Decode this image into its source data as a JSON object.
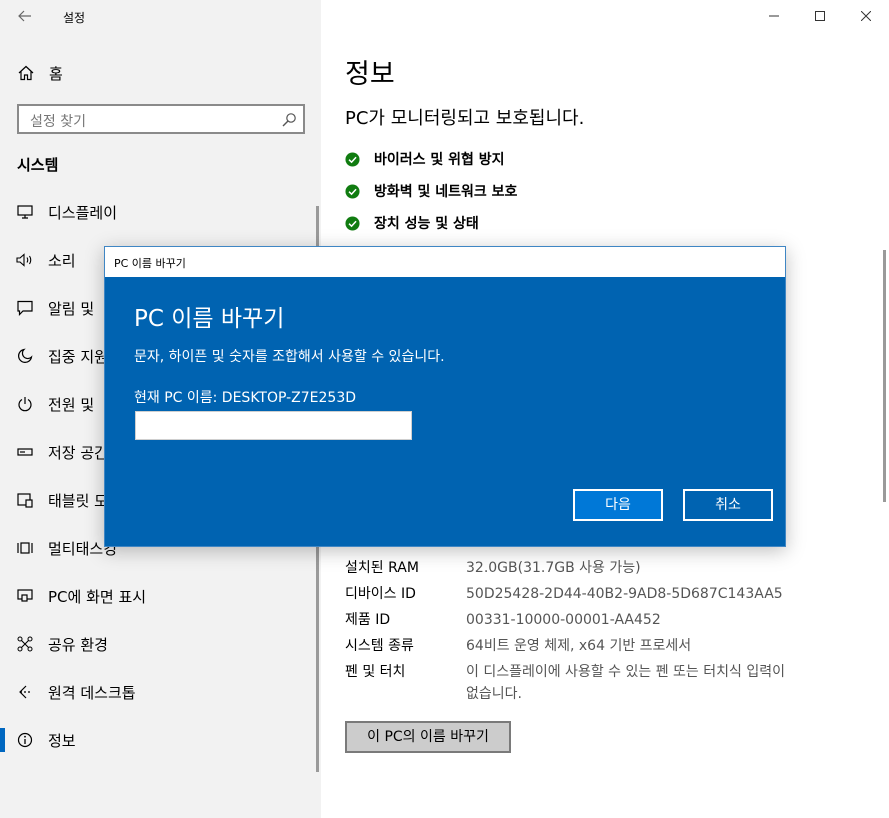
{
  "window": {
    "title": "설정"
  },
  "sidebar": {
    "home_label": "홈",
    "search_placeholder": "설정 찾기",
    "section_title": "시스템",
    "items": [
      {
        "label": "디스플레이",
        "icon": "monitor-icon"
      },
      {
        "label": "소리",
        "icon": "speaker-icon"
      },
      {
        "label": "알림 및",
        "icon": "notification-icon"
      },
      {
        "label": "집중 지원",
        "icon": "moon-icon"
      },
      {
        "label": "전원 및",
        "icon": "power-icon"
      },
      {
        "label": "저장 공간",
        "icon": "storage-icon"
      },
      {
        "label": "태블릿 모드",
        "icon": "tablet-icon"
      },
      {
        "label": "멀티태스킹",
        "icon": "multitask-icon"
      },
      {
        "label": "PC에 화면 표시",
        "icon": "project-icon"
      },
      {
        "label": "공유 환경",
        "icon": "share-icon"
      },
      {
        "label": "원격 데스크톱",
        "icon": "remote-icon"
      },
      {
        "label": "정보",
        "icon": "info-icon"
      }
    ],
    "active_index": 11
  },
  "main": {
    "title": "정보",
    "subtitle": "PC가 모니터링되고 보호됩니다.",
    "protection": [
      {
        "label": "바이러스 및 위협 방지"
      },
      {
        "label": "방화벽 및 네트워크 보호"
      },
      {
        "label": "장치 성능 및 상태"
      }
    ],
    "specs": [
      {
        "key": "설치된 RAM",
        "value": "32.0GB(31.7GB 사용 가능)"
      },
      {
        "key": "디바이스 ID",
        "value": "50D25428-2D44-40B2-9AD8-5D687C143AA5"
      },
      {
        "key": "제품 ID",
        "value": "00331-10000-00001-AA452"
      },
      {
        "key": "시스템 종류",
        "value": "64비트 운영 체제, x64 기반 프로세서"
      },
      {
        "key": "펜 및 터치",
        "value": "이 디스플레이에 사용할 수 있는 펜 또는 터치식 입력이 없습니다."
      }
    ],
    "rename_button": "이 PC의 이름 바꾸기"
  },
  "dialog": {
    "window_title": "PC 이름 바꾸기",
    "heading": "PC 이름 바꾸기",
    "description": "문자, 하이픈 및 숫자를 조합해서 사용할 수 있습니다.",
    "current_name": "현재 PC 이름: DESKTOP-Z7E253D",
    "input_value": "",
    "next_button": "다음",
    "cancel_button": "취소"
  },
  "colors": {
    "accent": "#0078d7",
    "dialog_bg": "#0063b1",
    "sidebar_bg": "#f2f2f2",
    "check_green": "#107c10"
  }
}
